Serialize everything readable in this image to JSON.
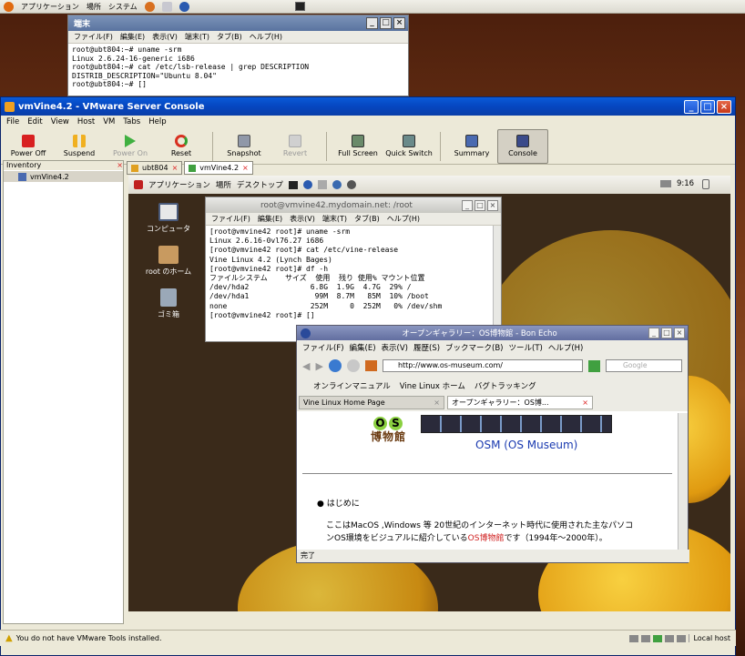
{
  "host_panel": {
    "apps": "アプリケーション",
    "places": "場所",
    "system": "システム"
  },
  "host_terminal": {
    "title": "端末",
    "menu": [
      "ファイル(F)",
      "編集(E)",
      "表示(V)",
      "端末(T)",
      "タブ(B)",
      "ヘルプ(H)"
    ],
    "lines": "root@ubt804:~# uname -srm\nLinux 2.6.24-16-generic i686\nroot@ubt804:~# cat /etc/lsb-release | grep DESCRIPTION\nDISTRIB_DESCRIPTION=\"Ubuntu 8.04\"\nroot@ubt804:~# []"
  },
  "vmware": {
    "title": "vmVine4.2 - VMware Server Console",
    "menu": [
      "File",
      "Edit",
      "View",
      "Host",
      "VM",
      "Tabs",
      "Help"
    ],
    "toolbar": {
      "power_off": "Power Off",
      "suspend": "Suspend",
      "power_on": "Power On",
      "reset": "Reset",
      "snapshot": "Snapshot",
      "revert": "Revert",
      "full_screen": "Full Screen",
      "quick_switch": "Quick Switch",
      "summary": "Summary",
      "console": "Console"
    },
    "inventory_label": "Inventory",
    "inventory_item": "vmVine4.2",
    "tabs": [
      "ubt804",
      "vmVine4.2"
    ],
    "status_msg": "You do not have VMware Tools installed.",
    "status_host": "Local host"
  },
  "guest": {
    "panel": {
      "apps": "アプリケーション",
      "places": "場所",
      "desktop": "デスクトップ",
      "clock": "9:16"
    },
    "icons": {
      "computer": "コンピュータ",
      "home": "root のホーム",
      "trash": "ゴミ箱"
    },
    "terminal": {
      "title": "root@vmvine42.mydomain.net: /root",
      "menu": [
        "ファイル(F)",
        "編集(E)",
        "表示(V)",
        "端末(T)",
        "タブ(B)",
        "ヘルプ(H)"
      ],
      "lines": "[root@vmvine42 root]# uname -srm\nLinux 2.6.16-0vl76.27 i686\n[root@vmvine42 root]# cat /etc/vine-release\nVine Linux 4.2 (Lynch Bages)\n[root@vmvine42 root]# df -h\nファイルシステム    サイズ  使用  残り 使用% マウント位置\n/dev/hda2              6.8G  1.9G  4.7G  29% /\n/dev/hda1               99M  8.7M   85M  10% /boot\nnone                   252M     0  252M   0% /dev/shm\n[root@vmvine42 root]# []"
    },
    "firefox": {
      "title": "オープンギャラリー：OS博物館 - Bon Echo",
      "menu": [
        "ファイル(F)",
        "編集(E)",
        "表示(V)",
        "履歴(S)",
        "ブックマーク(B)",
        "ツール(T)",
        "ヘルプ(H)"
      ],
      "url": "http://www.os-museum.com/",
      "search_placeholder": "Google",
      "bookmarks": [
        "オンラインマニュアル",
        "Vine Linux ホーム",
        "バグトラッキング"
      ],
      "tabs": [
        "Vine Linux Home Page",
        "オープンギャラリー：OS博..."
      ],
      "logo_chars": [
        "O",
        "S",
        "博",
        "物",
        "館"
      ],
      "site_title": "OSM (OS Museum)",
      "bullet": "はじめに",
      "para1": "ここはMacOS ,Windows 等 20世紀のインターネット時代に使用された主なパソコ",
      "para2a": "ンOS環境をビジュアルに紹介している",
      "para2link": "OS博物館",
      "para2b": "です（1994年～2000年）。",
      "status": "完了"
    }
  }
}
